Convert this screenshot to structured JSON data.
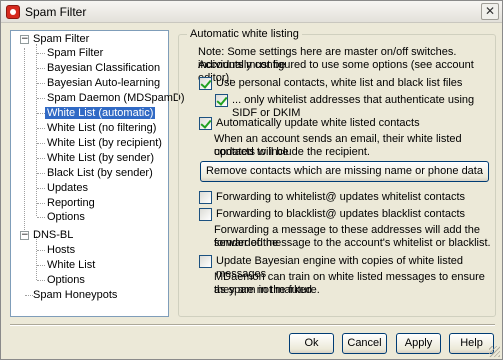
{
  "window": {
    "title": "Spam Filter",
    "close_symbol": "✕"
  },
  "tree": {
    "root1": {
      "label": "Spam Filter",
      "expander": "−"
    },
    "root1_children": [
      "Spam Filter",
      "Bayesian Classification",
      "Bayesian Auto-learning",
      "Spam Daemon (MDSpamD)",
      "White List (automatic)",
      "White List (no filtering)",
      "White List (by recipient)",
      "White List (by sender)",
      "Black List (by sender)",
      "Updates",
      "Reporting",
      "Options"
    ],
    "selected_item": "White List (automatic)",
    "root2": {
      "label": "DNS-BL",
      "expander": "−"
    },
    "root2_children": [
      "Hosts",
      "White List",
      "Options"
    ],
    "root3": {
      "label": "Spam Honeypots"
    }
  },
  "panel": {
    "legend": "Automatic white listing",
    "note_line1": "Note: Some settings here are master on/off switches.  Accounts must be",
    "note_line2": "individually configured to use some options (see account editor).",
    "options": {
      "use_personal": {
        "label": "Use personal contacts, white list and black list files",
        "checked": true
      },
      "only_sidf": {
        "label": "... only whitelist addresses that authenticate using SIDF or DKIM",
        "checked": true
      },
      "auto_update": {
        "label": "Automatically update white listed contacts",
        "checked": true
      },
      "auto_update_desc1": "When an account sends an email, their white listed contacts will be",
      "auto_update_desc2": "updated to include the recipient.",
      "remove_button": "Remove contacts which are missing name or phone data",
      "fwd_whitelist": {
        "label": "Forwarding to whitelist@ updates whitelist contacts",
        "checked": false
      },
      "fwd_blacklist": {
        "label": "Forwarding to blacklist@ updates blacklist contacts",
        "checked": false
      },
      "fwd_desc1": "Forwarding a message to these addresses will add the sender of the",
      "fwd_desc2": "forwarded message to the account's whitelist or blacklist.",
      "bayes": {
        "label": "Update Bayesian engine with copies of white listed messages",
        "checked": false
      },
      "bayes_desc1": "MDaemon can train on white listed messages to ensure they are not marked",
      "bayes_desc2": "as spam in the future."
    }
  },
  "buttons": {
    "ok": "Ok",
    "cancel": "Cancel",
    "apply": "Apply",
    "help": "Help"
  }
}
